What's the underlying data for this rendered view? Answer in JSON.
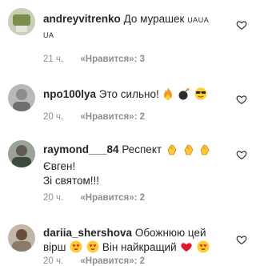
{
  "comments": [
    {
      "username": "andreyvitrenko",
      "text": "До мурашек",
      "flag_text": "UAUA",
      "flag_text_2": "UA",
      "time": "21 ч.",
      "likes": "«Нравится»: 3",
      "avatar_color": "#b7c3a0",
      "emojis": []
    },
    {
      "username": "npo100lya",
      "text": "Это сильно!",
      "time": "20 ч.",
      "likes": "«Нравится»: 2",
      "avatar_color": "#a9a9a9",
      "emojis": [
        "fire",
        "bomb",
        "sunglasses-face"
      ]
    },
    {
      "username": "raymond___84",
      "text": "Респект",
      "line2": "Євген!",
      "line3": "Зі святом!!!",
      "time": "20 ч.",
      "likes": "«Нравится»: 2",
      "avatar_color": "#7f8a7a",
      "emojis": [
        "clapping-hands",
        "clapping-hands",
        "clapping-hands"
      ]
    },
    {
      "username": "dariia_shershova",
      "text": "Обожнюю цей",
      "line2": "вірш",
      "line2b": "Він найкращий",
      "time": "20 ч.",
      "likes": "«Нравится»: 2",
      "avatar_color": "#9a8b7e",
      "emojis": [
        "heart-eyes-face",
        "heart-eyes-face",
        "heart-eyes-face",
        "red-heart",
        "heart-eyes-face"
      ]
    }
  ]
}
